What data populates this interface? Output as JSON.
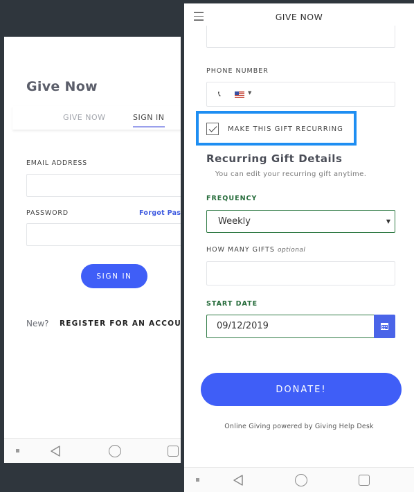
{
  "left": {
    "title": "Give Now",
    "tabs": [
      {
        "label": "GIVE NOW",
        "active": false
      },
      {
        "label": "SIGN IN",
        "active": true
      }
    ],
    "email_label": "EMAIL ADDRESS",
    "email_value": "",
    "password_label": "PASSWORD",
    "password_value": "",
    "forgot_link": "Forgot Pass",
    "signin_button": "SIGN IN",
    "new_text": "New?",
    "register_link": "REGISTER FOR AN ACCOUNT",
    "accent_color": "#3f5ef7"
  },
  "right": {
    "header_title": "GIVE NOW",
    "phone_label": "PHONE NUMBER",
    "phone_value": "",
    "recurring_label": "MAKE THIS GIFT RECURRING",
    "recurring_checked": true,
    "recurring_heading": "Recurring Gift Details",
    "recurring_sub": "You can edit your recurring gift anytime.",
    "frequency_label": "FREQUENCY",
    "frequency_value": "Weekly",
    "how_many_label": "HOW MANY GIFTS",
    "how_many_optional": "optional",
    "how_many_value": "",
    "start_date_label": "START DATE",
    "start_date_value": "09/12/2019",
    "donate_button": "DONATE!",
    "powered_by": "Online Giving powered by Giving Help Desk",
    "accent_color": "#3f5ef7",
    "highlight_color": "#1e8ef2",
    "focus_color": "#2f7a44"
  },
  "icons": {
    "menu": "hamburger-icon",
    "phone": "phone-icon",
    "flag": "us-flag-icon",
    "calendar": "calendar-icon",
    "nav": [
      "back-icon",
      "home-icon",
      "recents-icon"
    ]
  }
}
